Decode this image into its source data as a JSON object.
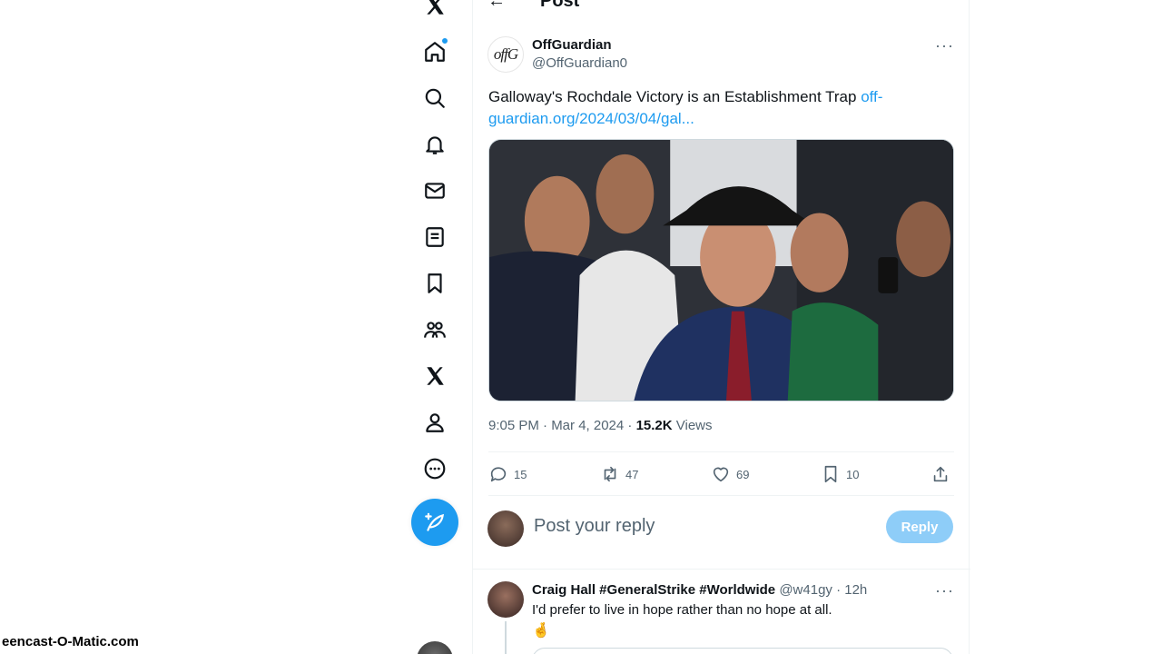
{
  "nav": {
    "items": [
      {
        "icon": "x-logo-icon"
      },
      {
        "icon": "home-icon",
        "has_notification_dot": true
      },
      {
        "icon": "search-icon"
      },
      {
        "icon": "bell-icon"
      },
      {
        "icon": "mail-icon"
      },
      {
        "icon": "lists-icon"
      },
      {
        "icon": "bookmark-icon"
      },
      {
        "icon": "communities-icon"
      },
      {
        "icon": "x-premium-icon"
      },
      {
        "icon": "profile-icon"
      },
      {
        "icon": "more-circle-icon"
      }
    ],
    "compose_icon": "feather-plus-icon"
  },
  "header": {
    "back_glyph": "←",
    "title": "Post"
  },
  "post": {
    "avatar_logo": "offG",
    "author_name": "OffGuardian",
    "author_handle": "@OffGuardian0",
    "more_glyph": "···",
    "text": "Galloway's Rochdale Victory is an Establishment Trap ",
    "link": "off-guardian.org/2024/03/04/gal...",
    "meta_time": "9:05 PM · Mar 4, 2024 · ",
    "views_count": "15.2K",
    "views_label": " Views",
    "stats": {
      "replies": "15",
      "reposts": "47",
      "likes": "69",
      "bookmarks": "10"
    }
  },
  "reply_box": {
    "placeholder": "Post your reply",
    "button_label": "Reply"
  },
  "comment": {
    "name": "Craig Hall #GeneralStrike #Worldwide",
    "handle": " @w41gy · 12h",
    "more_glyph": "···",
    "text": "I'd prefer to live in hope rather than no hope at all.",
    "emoji": "🤞"
  },
  "watermark": "eencast-O-Matic.com",
  "colors": {
    "accent": "#1d9bf0",
    "reply_button_disabled": "#8ecdf8",
    "secondary_text": "#536471"
  }
}
